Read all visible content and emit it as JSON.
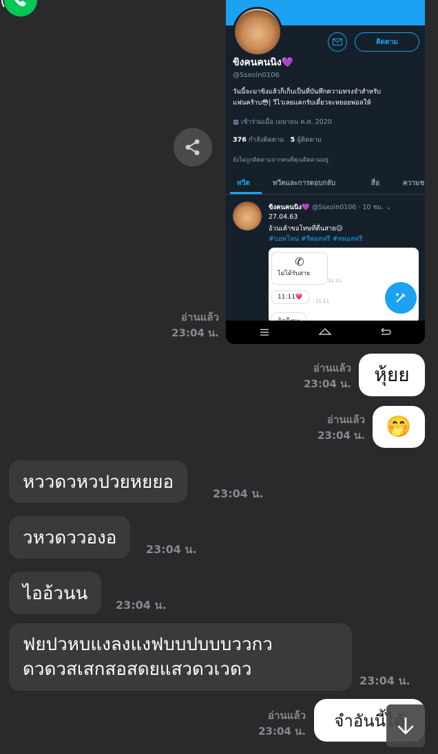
{
  "colors": {
    "background": "#2a2a2c",
    "incoming_bubble": "#3a3a3c",
    "outgoing_bubble": "#ffffff",
    "twitter_blue": "#1da1f2",
    "twitter_bg": "#15202b",
    "call_green": "#06c755"
  },
  "screenshot": {
    "follow_label": "ติดตาม",
    "name": "ขิงคนคนนิง💜",
    "handle": "@Ssxoin0106",
    "bio_line1": "วันนี้จะมาขิงแล้วก็เก็บเป็นที่บันทึกความทรงจำสำหรับ",
    "bio_line2": "แฟนคร้าบ😳| วีไวเลยแคกรับเดี๋ยวจะหยอยพ่อลให้",
    "joined": "เข้าร่วมเมื่อ เมษายน ค.ศ. 2020",
    "following_count": "376",
    "following_label": "กำลังติดตาม",
    "followers_count": "5",
    "followers_label": "ผู้ติดตาม",
    "not_followed": "ยังไม่ถูกติดตามจากคนที่คุณติดตามอยู่",
    "tabs": [
      "ทวีต",
      "ทวีตและการตอบกลับ",
      "สื่อ",
      "ความช"
    ],
    "tweet_name": "ขิงคนคนนิง💜",
    "tweet_meta": "@Ssxoin0106 · 10 ชม.",
    "tweet_date": "27.04.63",
    "tweet_text": "อ้วนเค้าขอโทษที่ตื่นสาย😕",
    "tweet_tags": "#บอทโหน่ #รีพ่อลฟรี #ทพ่อลฟรี",
    "media_missed_call": "ไม่ได้รับสาย",
    "media_time_a": "11:11",
    "media_clock": "11:11💗",
    "media_time_b": "11:11",
    "media_partial": "คิดถึงนะ"
  },
  "messages": [
    {
      "direction": "read_meta",
      "read": "อ่านแล้ว",
      "time": "23:04 น."
    },
    {
      "direction": "out",
      "text": "หุ้ยย",
      "read": "อ่านแล้ว",
      "time": "23:04 น."
    },
    {
      "direction": "out",
      "text": "🤭",
      "read": "อ่านแล้ว",
      "time": "23:04 น."
    },
    {
      "direction": "in",
      "text": "หววดวหวปวยหยยอ",
      "time": "23:04 น."
    },
    {
      "direction": "in",
      "text": "วหวดววองอ",
      "time": "23:04 น."
    },
    {
      "direction": "in",
      "text": "ไออ้วนน",
      "time": "23:04 น."
    },
    {
      "direction": "in",
      "text_line1": "ฟยปวหบแงลงแงฟบบปบบบววกว",
      "text_line2": "ดวดวสเสกสอสดยแสวดวเวดว",
      "time": "23:04 น."
    },
    {
      "direction": "out",
      "text": "จำอันนี้ได้",
      "read": "อ่านแล้ว",
      "time": "23:04 น."
    }
  ],
  "icons": {
    "call": "phone-call-icon",
    "share": "share-icon",
    "mail": "mail-icon",
    "compose": "compose-tweet-icon",
    "scroll": "arrow-down-icon"
  }
}
